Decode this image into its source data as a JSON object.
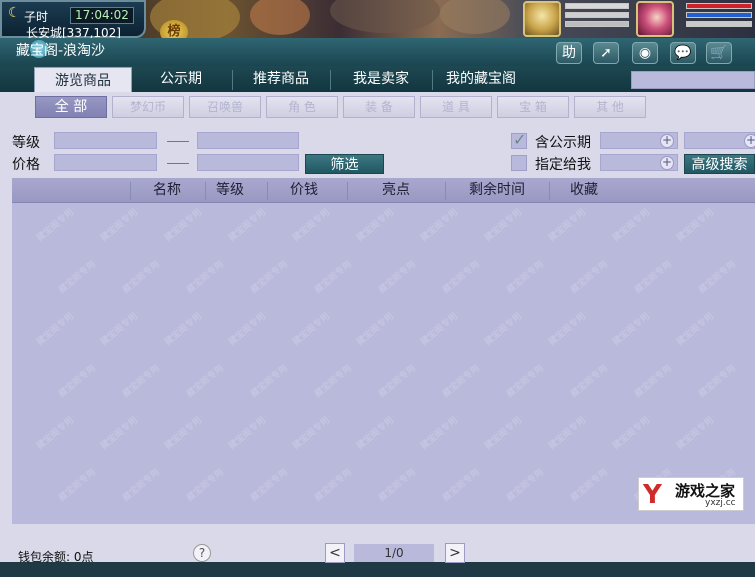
{
  "hud": {
    "shichen": "子时",
    "clock": "17:04:02",
    "location": "长安城[337,102]",
    "seal_glyph": "榜",
    "moon_icon": "crescent-moon-icon"
  },
  "window": {
    "title": "藏宝阁-浪淘沙",
    "title_buttons": [
      {
        "label": "助",
        "icon": "help-icon"
      },
      {
        "label": "➚",
        "icon": "share-arrow-icon"
      },
      {
        "label": "◉",
        "icon": "record-icon"
      },
      {
        "label": "💬",
        "icon": "chat-bubble-icon"
      },
      {
        "label": "🛒",
        "icon": "cart-icon"
      }
    ]
  },
  "tabs": [
    "游览商品",
    "公示期",
    "推荐商品",
    "我是卖家",
    "我的藏宝阁"
  ],
  "categories": [
    "全 部",
    "梦幻币",
    "召唤兽",
    "角 色",
    "装 备",
    "道 具",
    "宝 箱",
    "其 他"
  ],
  "filters": {
    "level_label": "等级",
    "price_label": "价格",
    "filter_button": "筛选",
    "public_label": "含公示期",
    "assign_label": "指定给我",
    "advanced_button": "高级搜索"
  },
  "table": {
    "columns": [
      "名称",
      "等级",
      "价钱",
      "亮点",
      "剩余时间",
      "收藏"
    ],
    "watermark": "藏宝阁专用"
  },
  "footer": {
    "wallet": "钱包余额: 0点",
    "help": "?",
    "prev": "<",
    "page": "1/0",
    "next": ">"
  },
  "logo": {
    "mark": "Y",
    "text": "游戏之家",
    "sub": "yxzj.cc"
  }
}
